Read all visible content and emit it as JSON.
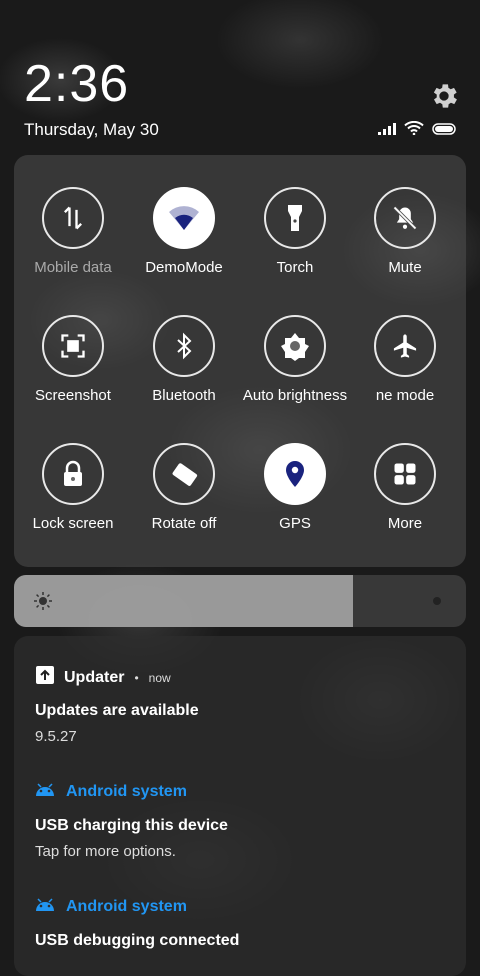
{
  "status": {
    "time": "2:36",
    "date": "Thursday, May 30"
  },
  "icons": {
    "settings": "gear-icon",
    "signal": "cell-signal-icon",
    "wifi": "wifi-icon",
    "battery": "battery-icon"
  },
  "tiles": [
    {
      "label": "Mobile data",
      "icon": "mobile-data-icon",
      "on": false,
      "dim": true
    },
    {
      "label": "DemoMode",
      "icon": "demo-mode-icon",
      "on": true,
      "dim": false
    },
    {
      "label": "Torch",
      "icon": "torch-icon",
      "on": false,
      "dim": false
    },
    {
      "label": "Mute",
      "icon": "mute-icon",
      "on": false,
      "dim": false
    },
    {
      "label": "Screenshot",
      "icon": "screenshot-icon",
      "on": false,
      "dim": false
    },
    {
      "label": "Bluetooth",
      "icon": "bluetooth-icon",
      "on": false,
      "dim": false
    },
    {
      "label": "Auto brightness",
      "icon": "auto-brightness-icon",
      "on": false,
      "dim": false
    },
    {
      "label": "ne mode",
      "icon": "airplane-icon",
      "on": false,
      "dim": false
    },
    {
      "label": "Lock screen",
      "icon": "lock-icon",
      "on": false,
      "dim": false
    },
    {
      "label": "Rotate off",
      "icon": "rotate-icon",
      "on": false,
      "dim": false
    },
    {
      "label": "GPS",
      "icon": "location-pin-icon",
      "on": true,
      "dim": false
    },
    {
      "label": "More",
      "icon": "more-grid-icon",
      "on": false,
      "dim": false
    }
  ],
  "brightness": {
    "level": 0.75
  },
  "notifications": [
    {
      "app": "Updater",
      "time": "now",
      "title": "Updates are available",
      "body": "9.5.27",
      "color": "#ffffff"
    },
    {
      "app": "Android system",
      "time": "",
      "title": "USB charging this device",
      "body": "Tap for more options.",
      "color": "#2196f3"
    },
    {
      "app": "Android system",
      "time": "",
      "title": "USB debugging connected",
      "body": "",
      "color": "#2196f3"
    }
  ]
}
